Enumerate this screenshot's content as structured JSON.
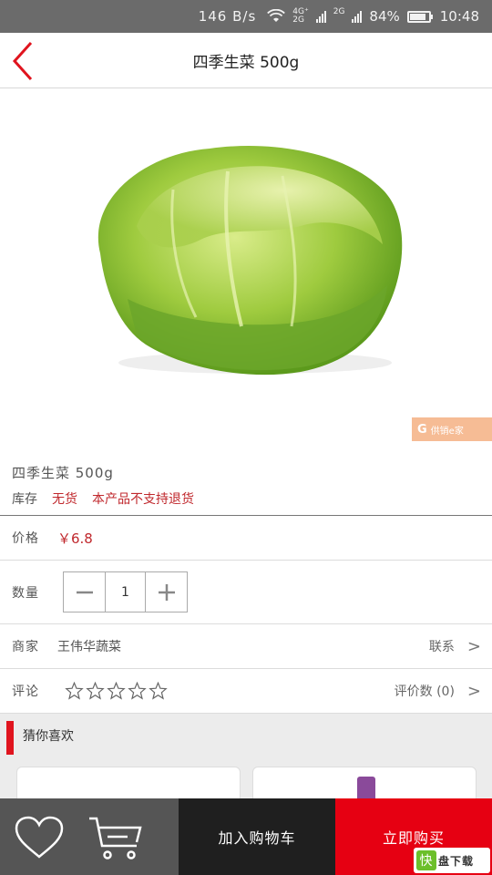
{
  "status_bar": {
    "speed": "146 B/s",
    "net_top": "4G⁺",
    "net_bottom": "2G",
    "net2": "2G",
    "battery": "84%",
    "time": "10:48"
  },
  "nav": {
    "title": "四季生菜 500g"
  },
  "watermark": {
    "text": "供销e家"
  },
  "product": {
    "name": "四季生菜 500g",
    "stock_label": "库存",
    "stock_status": "无货",
    "return_policy": "本产品不支持退货"
  },
  "price": {
    "label": "价格",
    "value": "￥6.8"
  },
  "quantity": {
    "label": "数量",
    "value": "1"
  },
  "shop": {
    "label": "商家",
    "name": "王伟华蔬菜",
    "contact": "联系"
  },
  "review": {
    "label": "评论",
    "count_label": "评价数 (0)",
    "rating": 0,
    "max_rating": 5
  },
  "guess": {
    "title": "猜你喜欢"
  },
  "bottom": {
    "add_to_cart": "加入购物车",
    "buy_now": "立即购买"
  },
  "badge": {
    "icon": "快",
    "text": "盘下载"
  },
  "colors": {
    "accent_red": "#e60012",
    "price_red": "#c0282d",
    "bottom_dark": "#1f1f1f",
    "bottom_gray": "#555555"
  }
}
